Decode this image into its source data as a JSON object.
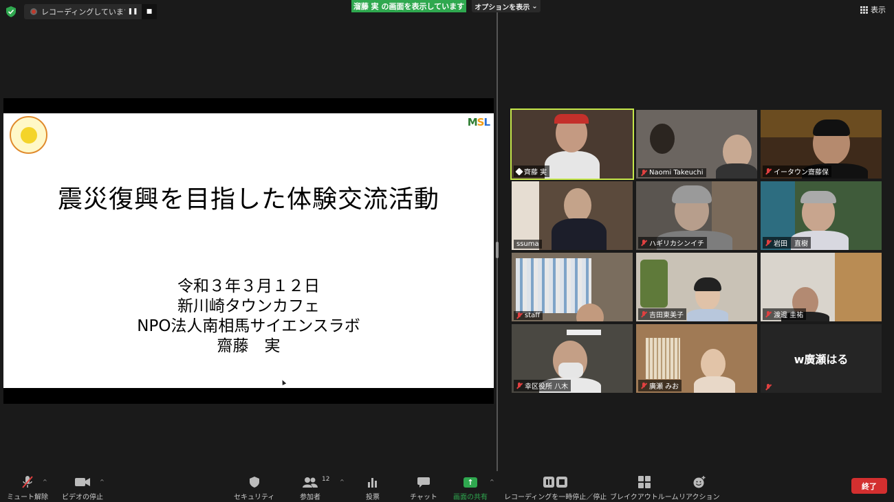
{
  "topbar": {
    "recording_text": "レコーディングしています...",
    "pause_symbol": "❚❚",
    "stop_symbol": "■",
    "share_label": "溜藤 実 の画面を表示しています",
    "options_label": "オプションを表示",
    "view_label": "表示"
  },
  "slide": {
    "title": "震災復興を目指した体験交流活動",
    "line1": "令和３年３月１２日",
    "line2": "新川崎タウンカフェ",
    "line3": "NPO法人南相馬サイエンスラボ",
    "line4": "齋藤　実",
    "logo_right": {
      "m": "M",
      "s": "S",
      "l": "L"
    }
  },
  "participants": [
    {
      "name": "齊藤 実",
      "pinned": true,
      "muted": false
    },
    {
      "name": "Naomi Takeuchi",
      "muted": true
    },
    {
      "name": "イータウン齋藤保",
      "muted": true
    },
    {
      "name": "ssuma",
      "muted": false
    },
    {
      "name": "ハギリカシンイチ",
      "muted": true
    },
    {
      "name": "岩田　直樹",
      "muted": true
    },
    {
      "name": "staff",
      "muted": true
    },
    {
      "name": "吉田東美子",
      "muted": true
    },
    {
      "name": "渡邊 圭祐",
      "muted": true
    },
    {
      "name": "幸区役所 八木",
      "muted": true
    },
    {
      "name": "廣瀬 みお",
      "muted": true
    },
    {
      "name": "w廣瀬はる",
      "muted": true
    }
  ],
  "toolbar": {
    "mute": "ミュート解除",
    "video": "ビデオの停止",
    "security": "セキュリティ",
    "participants": "参加者",
    "participants_count": "12",
    "poll": "投票",
    "chat": "チャット",
    "share": "画面の共有",
    "recording": "レコーディングを一時停止／停止",
    "breakout": "ブレイクアウトルーム",
    "reaction": "リアクション",
    "end": "終了",
    "caret": "^"
  }
}
